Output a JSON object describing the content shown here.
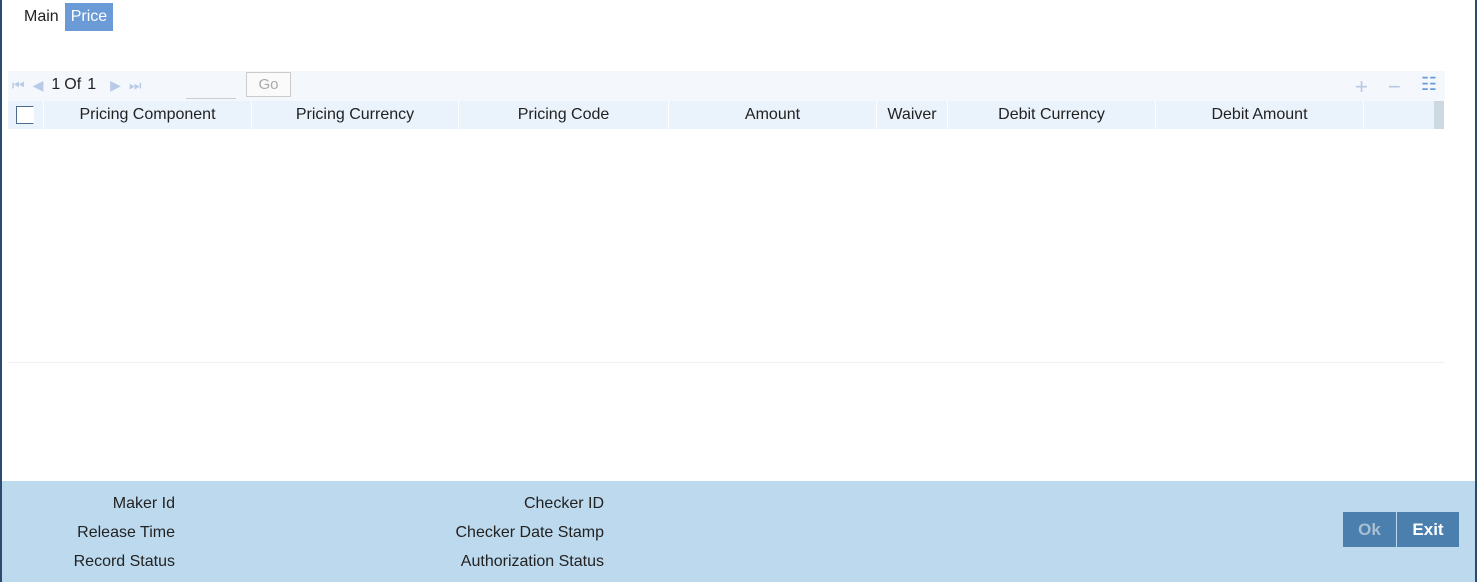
{
  "tabs": [
    {
      "label": "Main"
    },
    {
      "label": "Price"
    }
  ],
  "pager": {
    "current": "1",
    "of": "Of",
    "total": "1",
    "go": "Go"
  },
  "columns": [
    "Pricing Component",
    "Pricing Currency",
    "Pricing Code",
    "Amount",
    "Waiver",
    "Debit Currency",
    "Debit Amount"
  ],
  "footer": {
    "maker_id": "Maker Id",
    "release_time": "Release Time",
    "record_status": "Record Status",
    "checker_id": "Checker ID",
    "checker_date_stamp": "Checker Date Stamp",
    "authorization_status": "Authorization Status",
    "ok": "Ok",
    "exit": "Exit"
  },
  "colors": {
    "accent": "#6b9bd6",
    "footer_bg": "#bcd9ee",
    "button": "#4a7fae"
  }
}
